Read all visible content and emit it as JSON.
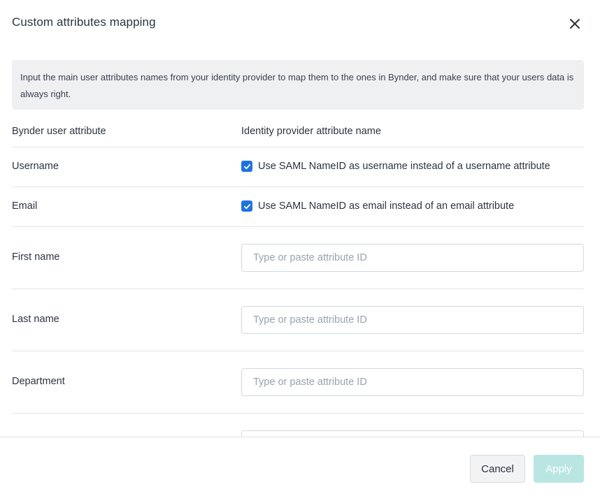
{
  "dialog": {
    "title": "Custom attributes mapping"
  },
  "info_text": "Input the main user attributes names from your identity provider to map them to the ones in Bynder, and make sure that your users data is always right.",
  "columns": {
    "left": "Bynder user attribute",
    "right": "Identity provider attribute name"
  },
  "rows": [
    {
      "label": "Username",
      "checkbox_label": "Use SAML NameID as username instead of a username attribute",
      "checked": true
    },
    {
      "label": "Email",
      "checkbox_label": "Use SAML NameID as email instead of an email attribute",
      "checked": true
    },
    {
      "label": "First name",
      "placeholder": "Type or paste attribute ID",
      "value": ""
    },
    {
      "label": "Last name",
      "placeholder": "Type or paste attribute ID",
      "value": ""
    },
    {
      "label": "Department",
      "placeholder": "Type or paste attribute ID",
      "value": ""
    }
  ],
  "footer": {
    "cancel_label": "Cancel",
    "apply_label": "Apply"
  },
  "icons": {
    "close": "close-icon",
    "check": "checkmark-icon"
  },
  "colors": {
    "checkbox": "#1f73e0",
    "apply_disabled": "#b9e6e2",
    "info_background": "#eef0f2"
  }
}
